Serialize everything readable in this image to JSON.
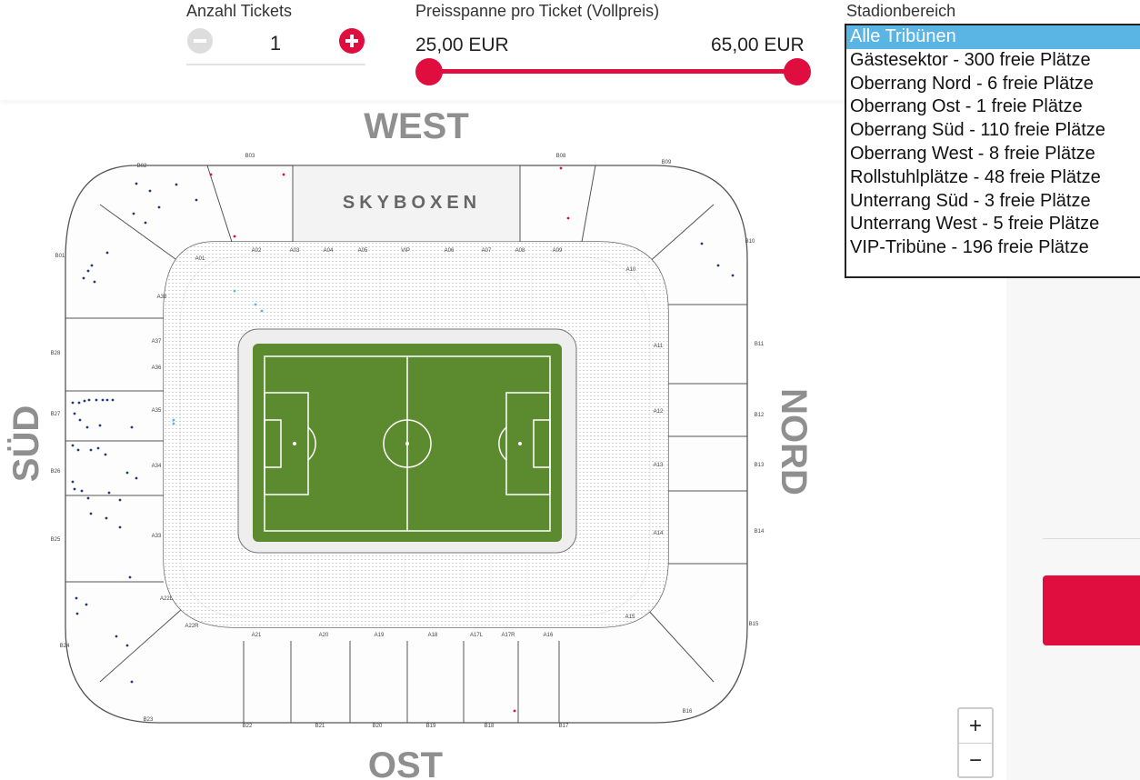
{
  "tickets": {
    "label": "Anzahl Tickets",
    "value": "1"
  },
  "price_range": {
    "label": "Preisspanne pro Ticket (Vollpreis)",
    "min_text": "25,00 EUR",
    "max_text": "65,00 EUR"
  },
  "area": {
    "label": "Stadionbereich",
    "options": [
      "Alle Tribünen",
      "Gästesektor - 300 freie Plätze",
      "Oberrang Nord - 6 freie Plätze",
      "Oberrang Ost - 1 freie Plätze",
      "Oberrang Süd - 110 freie Plätze",
      "Oberrang West - 8 freie Plätze",
      "Rollstuhlplätze - 48 freie Plätze",
      "Unterrang Süd - 3 freie Plätze",
      "Unterrang West - 5 freie Plätze",
      "VIP-Tribüne - 196 freie Plätze"
    ],
    "selected_index": 0
  },
  "stadium": {
    "stands": {
      "west": "WEST",
      "ost": "OST",
      "sued": "SÜD",
      "nord": "NORD"
    },
    "skyboxen": "SKYBOXEN",
    "blocks_top": [
      "A02",
      "A03",
      "A04",
      "A05",
      "VIP",
      "A06",
      "A07",
      "A08",
      "A09"
    ],
    "blocks_bottom": [
      "A21",
      "A20",
      "A19",
      "A18",
      "A17L",
      "A17R",
      "A16"
    ],
    "blocks_outer_bottom": [
      "B22",
      "B21",
      "B20",
      "B19",
      "B18",
      "B17"
    ],
    "blocks_left": [
      "A37",
      "A36",
      "A35",
      "A34",
      "A33"
    ],
    "blocks_right": [
      "A11",
      "A12",
      "A13",
      "A14"
    ],
    "blocks_outer_left": [
      "B28",
      "B27",
      "B26",
      "B25"
    ],
    "blocks_outer_right": [
      "B11",
      "B12",
      "B13",
      "B14"
    ],
    "corners": [
      "B01",
      "B02",
      "B03",
      "B08",
      "B09",
      "B10",
      "A01",
      "A38",
      "A10",
      "A15",
      "A22L",
      "A22R",
      "B15",
      "B16",
      "B23",
      "B24"
    ]
  },
  "zoom": {
    "in": "+",
    "out": "−"
  },
  "colors": {
    "accent": "#e00d3f",
    "pitch": "#5c8a2e",
    "selected": "#5bb5e4",
    "seat_available": "#1f3a7a"
  }
}
